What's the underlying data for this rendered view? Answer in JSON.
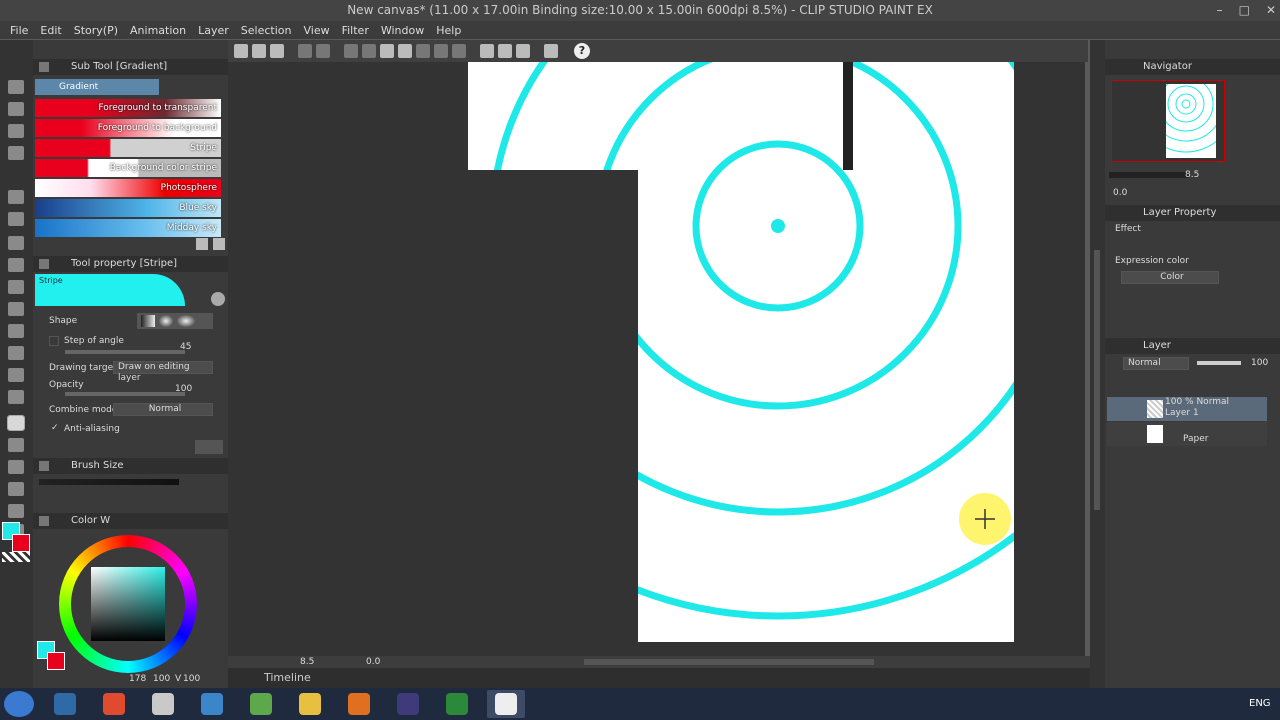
{
  "app": {
    "title": "New canvas* (11.00 x 17.00in Binding size:10.00 x 15.00in 600dpi 8.5%)  - CLIP STUDIO PAINT EX",
    "window_controls": [
      "–",
      "□",
      "✕"
    ]
  },
  "menu": [
    "File",
    "Edit",
    "Story(P)",
    "Animation",
    "Layer",
    "Selection",
    "View",
    "Filter",
    "Window",
    "Help"
  ],
  "help_label": "?",
  "subtool": {
    "header": "Sub Tool [Gradient]",
    "group": "Gradient",
    "items": [
      {
        "label": "Foreground to transparent",
        "css": "linear-gradient(90deg,#e8001c 0%,#e8001c 30%,rgba(232,0,28,0.3) 70%,#fff 100%)"
      },
      {
        "label": "Foreground to background",
        "css": "linear-gradient(90deg,#e8001c 0%,#e8001c 25%,#fff 75%,#fff 100%)"
      },
      {
        "label": "Stripe",
        "css": "linear-gradient(90deg,#e8001c 0%,#e8001c 40%,#d0d0d0 41%,#d0d0d0 100%)"
      },
      {
        "label": "Background color stripe",
        "css": "linear-gradient(90deg,#e8001c 0%,#e8001c 28%,#fff 29%,#fff 55%,#bbb 56%,#bbb 100%)"
      },
      {
        "label": "Photosphere",
        "css": "linear-gradient(90deg,#fff 0%,#fde 30%,#e00 70%,#e8001c 100%)"
      },
      {
        "label": "Blue sky",
        "css": "linear-gradient(90deg,#1a3f8a 0%,#4fb4e8 60%,#bfe6f5 100%)"
      },
      {
        "label": "Midday sky",
        "css": "linear-gradient(90deg,#1872c8 0%,#6ac0ee 60%,#c9e9f7 100%)"
      }
    ]
  },
  "toolprop": {
    "header": "Tool property [Stripe]",
    "preview_label": "Stripe",
    "shape_label": "Shape",
    "step_label": "Step of angle",
    "step_value": "45",
    "target_label": "Drawing target",
    "target_value": "Draw on editing layer",
    "opacity_label": "Opacity",
    "opacity_value": "100",
    "combine_label": "Combine mode",
    "combine_value": "Normal",
    "antialias_label": "Anti-aliasing",
    "antialias_check": "✓"
  },
  "brushsize": {
    "header": "Brush Size"
  },
  "color": {
    "header": "Color W",
    "fg": "#22e8e8",
    "bg": "#e8001c",
    "readout_a": "178",
    "readout_b": "100",
    "readout_c": "100",
    "v_label": "V"
  },
  "canvas": {
    "ring_color": "#1ee8e8",
    "zoom": "8.5",
    "rotation": "0.0"
  },
  "timeline": {
    "label": "Timeline"
  },
  "navigator": {
    "header": "Navigator",
    "zoom": "8.5",
    "rotation": "0.0"
  },
  "layerprop": {
    "header": "Layer Property",
    "effect_label": "Effect",
    "expression_label": "Expression color",
    "expression_value": "Color"
  },
  "layers": {
    "header": "Layer",
    "blend_mode": "Normal",
    "opacity": "100",
    "items": [
      {
        "line1": "100 %  Normal",
        "line2": "Layer 1"
      },
      {
        "line1": "",
        "line2": "Paper"
      }
    ]
  },
  "taskbar": {
    "lang": "ENG",
    "apps": [
      {
        "name": "windows-media-icon",
        "color": "#2f6aa6"
      },
      {
        "name": "chrome-icon",
        "color": "#e04a2f"
      },
      {
        "name": "mu-icon",
        "color": "#c9c9c9"
      },
      {
        "name": "control-panel-icon",
        "color": "#3a86c8"
      },
      {
        "name": "android-studio-icon",
        "color": "#5ca84a"
      },
      {
        "name": "file-explorer-icon",
        "color": "#e7c042"
      },
      {
        "name": "firefox-icon",
        "color": "#e0701f"
      },
      {
        "name": "eclipse-icon",
        "color": "#3f3a7a"
      },
      {
        "name": "camtasia-icon",
        "color": "#2a8a3a"
      },
      {
        "name": "clip-studio-icon",
        "color": "#eeeeee"
      }
    ]
  }
}
